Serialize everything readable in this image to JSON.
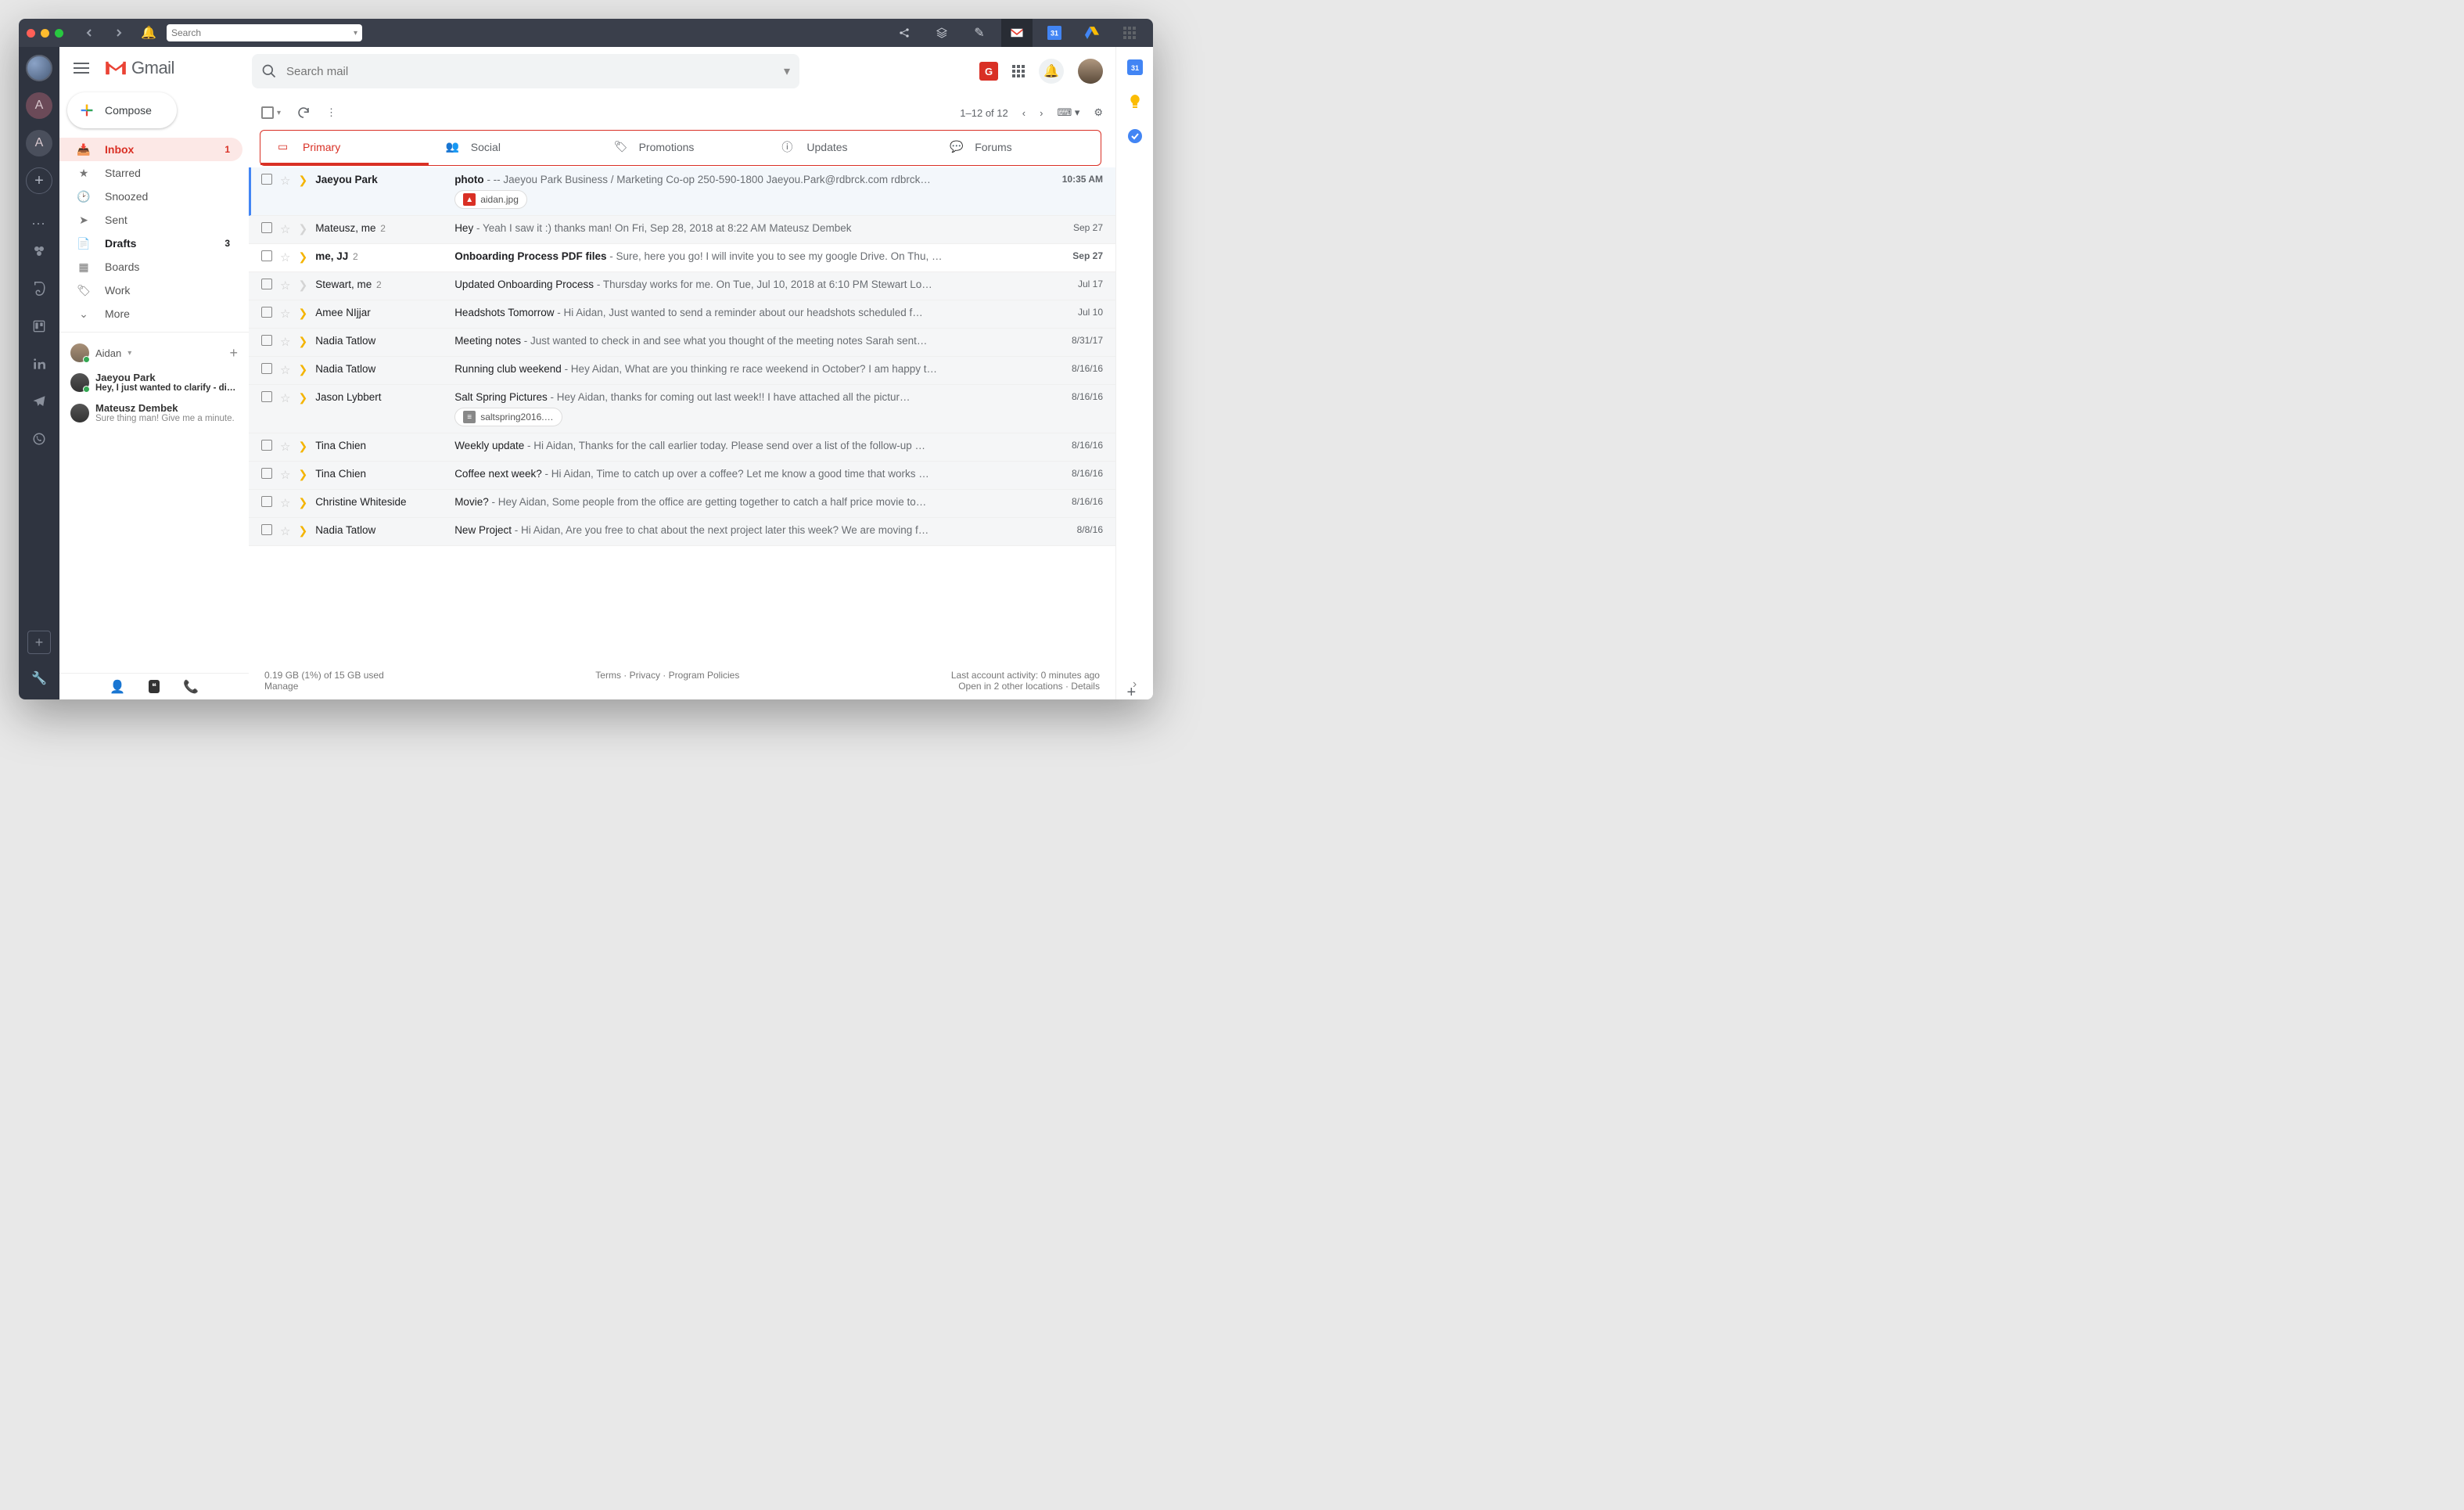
{
  "chrome": {
    "search_placeholder": "Search",
    "traffic": {
      "close": "#ff5f57",
      "min": "#febc2e",
      "max": "#28c840"
    }
  },
  "rail": {
    "avatars": [
      "",
      "A",
      "A"
    ],
    "apps": [
      "dots",
      "evernote",
      "trello",
      "linkedin",
      "telegram",
      "whatsapp"
    ]
  },
  "header": {
    "logo_text": "Gmail",
    "compose_label": "Compose",
    "search_placeholder": "Search mail",
    "addon_badge": "G"
  },
  "sidebar": {
    "folders": [
      {
        "icon": "inbox",
        "label": "Inbox",
        "count": "1",
        "active": true
      },
      {
        "icon": "star",
        "label": "Starred"
      },
      {
        "icon": "clock",
        "label": "Snoozed"
      },
      {
        "icon": "send",
        "label": "Sent"
      },
      {
        "icon": "draft",
        "label": "Drafts",
        "count": "3",
        "bold": true
      },
      {
        "icon": "boards",
        "label": "Boards"
      },
      {
        "icon": "label",
        "label": "Work"
      },
      {
        "icon": "more",
        "label": "More"
      }
    ],
    "hangouts": {
      "me": "Aidan",
      "chats": [
        {
          "name": "Jaeyou Park",
          "msg": "Hey, I just wanted to clarify - did yo",
          "bold": true
        },
        {
          "name": "Mateusz Dembek",
          "msg": "Sure thing man! Give me a minute."
        }
      ]
    }
  },
  "toolbar": {
    "pager": "1–12 of 12"
  },
  "tabs": [
    {
      "icon": "inbox",
      "label": "Primary",
      "active": true
    },
    {
      "icon": "people",
      "label": "Social"
    },
    {
      "icon": "tag",
      "label": "Promotions"
    },
    {
      "icon": "info",
      "label": "Updates"
    },
    {
      "icon": "forum",
      "label": "Forums"
    }
  ],
  "emails": [
    {
      "sender": "Jaeyou Park",
      "subject": "photo",
      "snippet": "-- Jaeyou Park Business / Marketing Co-op 250-590-1800 Jaeyou.Park@rdbrck.com rdbrck…",
      "date": "10:35 AM",
      "unread": true,
      "important": true,
      "selected": true,
      "attach": {
        "type": "img",
        "name": "aidan.jpg"
      }
    },
    {
      "sender": "Mateusz, me",
      "count": "2",
      "subject": "Hey",
      "snippet": "Yeah I saw it :) thanks man! On Fri, Sep 28, 2018 at 8:22 AM Mateusz Dembek <contact@dem…",
      "date": "Sep 27",
      "unread": false,
      "important_gold": false
    },
    {
      "sender": "me, JJ",
      "count": "2",
      "subject": "Onboarding Process PDF files",
      "snippet": "Sure, here you go! I will invite you to see my google Drive. On Thu, …",
      "date": "Sep 27",
      "unread": true,
      "important_gold": true
    },
    {
      "sender": "Stewart, me",
      "count": "2",
      "subject": "Updated Onboarding Process",
      "snippet": "Thursday works for me. On Tue, Jul 10, 2018 at 6:10 PM Stewart Lo…",
      "date": "Jul 17",
      "unread": false,
      "important_gold": false
    },
    {
      "sender": "Amee NIjjar",
      "subject": "Headshots Tomorrow",
      "snippet": "Hi Aidan, Just wanted to send a reminder about our headshots scheduled f…",
      "date": "Jul 10",
      "unread": false,
      "important_gold": true
    },
    {
      "sender": "Nadia Tatlow",
      "subject": "Meeting notes",
      "snippet": "Just wanted to check in and see what you thought of the meeting notes Sarah sent…",
      "date": "8/31/17",
      "unread": false,
      "important_gold": true
    },
    {
      "sender": "Nadia Tatlow",
      "subject": "Running club weekend",
      "snippet": "Hey Aidan, What are you thinking re race weekend in October? I am happy t…",
      "date": "8/16/16",
      "unread": false,
      "important_gold": true
    },
    {
      "sender": "Jason Lybbert",
      "subject": "Salt Spring Pictures",
      "snippet": "Hey Aidan, thanks for coming out last week!! I have attached all the pictur…",
      "date": "8/16/16",
      "unread": false,
      "important_gold": true,
      "attach": {
        "type": "doc",
        "name": "saltspring2016.…"
      }
    },
    {
      "sender": "Tina Chien",
      "subject": "Weekly update",
      "snippet": "Hi Aidan, Thanks for the call earlier today. Please send over a list of the follow-up …",
      "date": "8/16/16",
      "unread": false,
      "important_gold": true
    },
    {
      "sender": "Tina Chien",
      "subject": "Coffee next week?",
      "snippet": "Hi Aidan, Time to catch up over a coffee? Let me know a good time that works …",
      "date": "8/16/16",
      "unread": false,
      "important_gold": true
    },
    {
      "sender": "Christine Whiteside",
      "subject": "Movie?",
      "snippet": "Hey Aidan, Some people from the office are getting together to catch a half price movie to…",
      "date": "8/16/16",
      "unread": false,
      "important_gold": true
    },
    {
      "sender": "Nadia Tatlow",
      "subject": "New Project",
      "snippet": "Hi Aidan, Are you free to chat about the next project later this week? We are moving f…",
      "date": "8/8/16",
      "unread": false,
      "important_gold": true
    }
  ],
  "footer": {
    "storage": "0.19 GB (1%) of 15 GB used",
    "manage": "Manage",
    "links": [
      "Terms",
      "Privacy",
      "Program Policies"
    ],
    "activity": "Last account activity: 0 minutes ago",
    "locations": "Open in 2 other locations",
    "details": "Details"
  }
}
